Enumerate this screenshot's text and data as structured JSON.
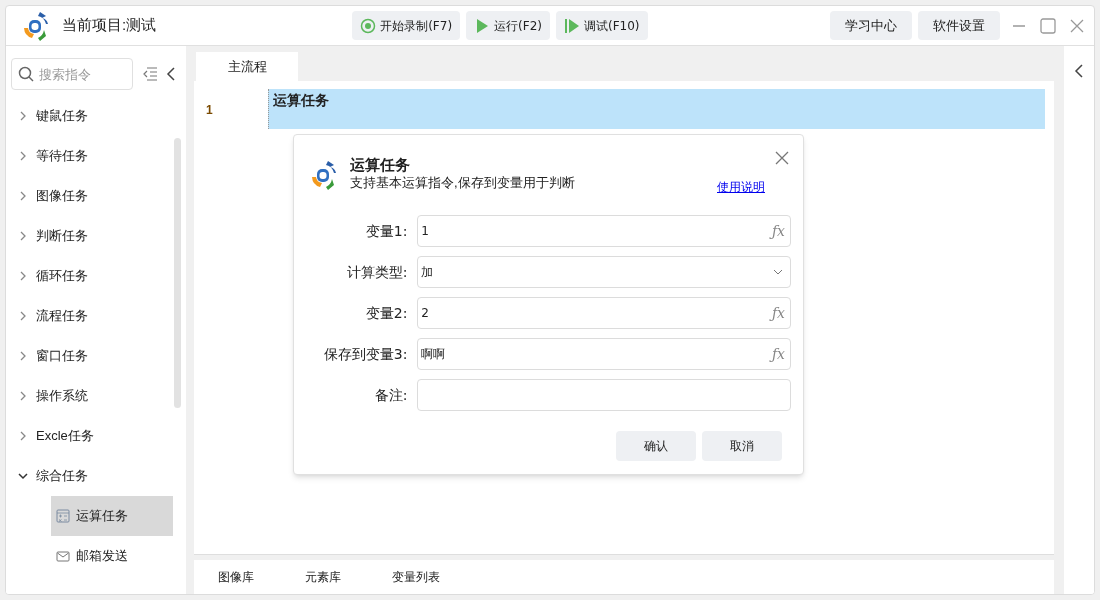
{
  "window": {
    "title": "当前项目:测试"
  },
  "toolbar": [
    {
      "label": "开始录制(F7)",
      "kind": "record"
    },
    {
      "label": "运行(F2)",
      "kind": "run"
    },
    {
      "label": "调试(F10)",
      "kind": "debug"
    }
  ],
  "header_buttons": [
    "学习中心",
    "软件设置"
  ],
  "sidebar": {
    "search": {
      "placeholder": "搜索指令"
    },
    "items": [
      {
        "label": "键鼠任务",
        "expanded": false
      },
      {
        "label": "等待任务",
        "expanded": false
      },
      {
        "label": "图像任务",
        "expanded": false
      },
      {
        "label": "判断任务",
        "expanded": false
      },
      {
        "label": "循环任务",
        "expanded": false
      },
      {
        "label": "流程任务",
        "expanded": false
      },
      {
        "label": "窗口任务",
        "expanded": false
      },
      {
        "label": "操作系统",
        "expanded": false
      },
      {
        "label": "Excle任务",
        "expanded": false
      },
      {
        "label": "综合任务",
        "expanded": true,
        "children": [
          {
            "label": "运算任务",
            "kind": "calc",
            "selected": true
          },
          {
            "label": "邮箱发送",
            "kind": "mail",
            "selected": false
          }
        ]
      }
    ]
  },
  "tabs": [
    {
      "label": "主流程",
      "selected": true
    }
  ],
  "flow": [
    {
      "number": "1",
      "label": "运算任务",
      "selected": true
    }
  ],
  "dialog": {
    "title": "运算任务",
    "subtitle": "支持基本运算指令,保存到变量用于判断",
    "help_link": "使用说明",
    "fields": [
      {
        "label": "变量1:",
        "kind": "fx",
        "value": "1",
        "button": "ƒx"
      },
      {
        "label": "计算类型:",
        "kind": "select",
        "value": "加"
      },
      {
        "label": "变量2:",
        "kind": "fx",
        "value": "2",
        "button": "ƒx"
      },
      {
        "label": "保存到变量3:",
        "kind": "fx",
        "value": "啊啊",
        "button": "ƒx"
      },
      {
        "label": "备注:",
        "kind": "text"
      }
    ],
    "buttons": [
      "确认",
      "取消"
    ]
  },
  "bottom_tabs": [
    "图像库",
    "元素库",
    "变量列表"
  ]
}
